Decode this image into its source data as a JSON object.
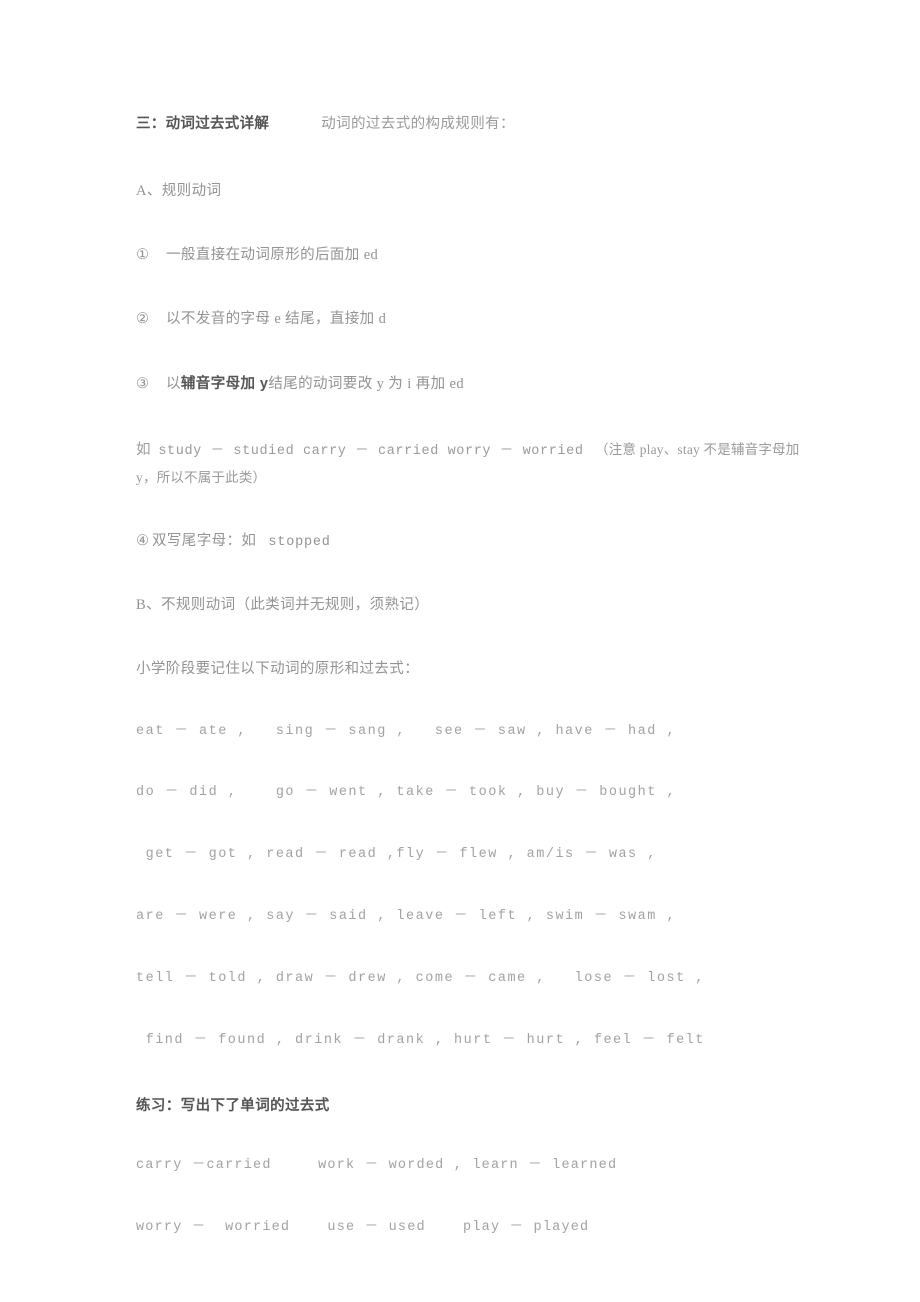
{
  "document": {
    "section_heading": {
      "title": "三：动词过去式详解",
      "lead_in": "动词的过去式的构成规则有："
    },
    "group_a": {
      "label": "A、规则动词",
      "rules": [
        {
          "marker": "①",
          "text_before": "一般直接在动词原形的后面加 ed",
          "emphasis": "",
          "text_after": ""
        },
        {
          "marker": "②",
          "text_before": "以不发音的字母 e 结尾，直接加 d",
          "emphasis": "",
          "text_after": ""
        },
        {
          "marker": "③",
          "text_before": "以",
          "emphasis": "辅音字母加 y",
          "text_after": "结尾的动词要改 y 为 i 再加 ed"
        }
      ],
      "examples_line": {
        "prefix": "如",
        "pairs": "study － studied  carry － carried  worry － worried",
        "note": "（注意 play、stay 不是辅音字母加 y，所以不属于此类）"
      },
      "rule_four": {
        "marker": "④",
        "text": "双写尾字母：如",
        "example": "stopped"
      }
    },
    "group_b": {
      "label": "B、不规则动词（此类词并无规则，须熟记）",
      "intro": "小学阶段要记住以下动词的原形和过去式：",
      "verb_lines": [
        "eat － ate ,   sing － sang ,   see － saw , have － had ,",
        "do － did ,    go － went , take － took , buy － bought ,",
        " get － got , read － read ,fly － flew , am/is － was ,",
        "are － were , say － said , leave － left , swim － swam ,",
        "tell － told , draw － drew , come － came ,   lose － lost ,",
        " find － found , drink － drank , hurt － hurt , feel － felt"
      ]
    },
    "practice": {
      "heading": "练习：写出下了单词的过去式",
      "lines": [
        "carry －carried     work － worded , learn － learned",
        "worry －  worried    use － used    play － played"
      ]
    }
  }
}
